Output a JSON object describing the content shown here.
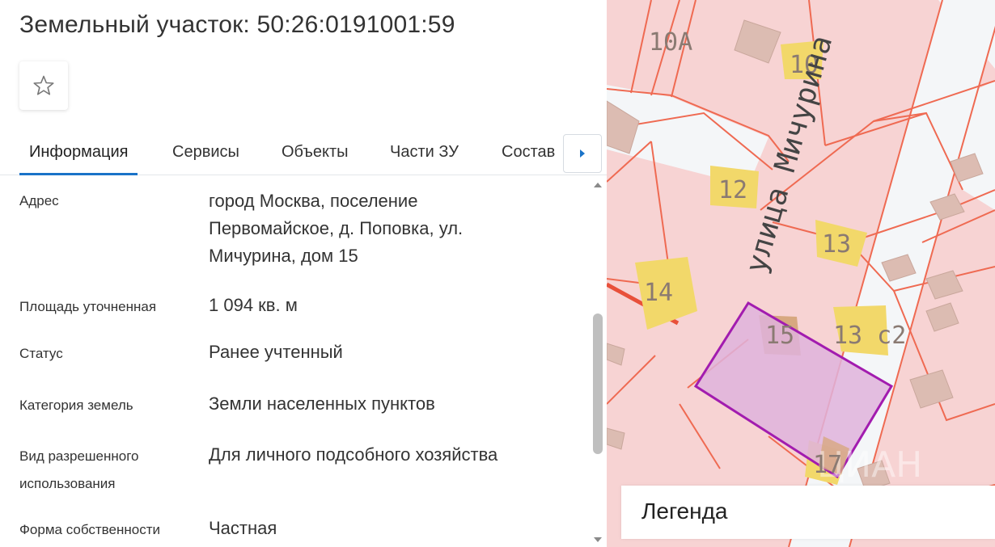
{
  "header": {
    "title": "Земельный участок: 50:26:0191001:59",
    "favorite_icon": "star-icon"
  },
  "tabs": [
    {
      "label": "Информация",
      "active": true
    },
    {
      "label": "Сервисы",
      "active": false
    },
    {
      "label": "Объекты",
      "active": false
    },
    {
      "label": "Части ЗУ",
      "active": false
    },
    {
      "label": "Состав",
      "active": false
    }
  ],
  "tabs_next_icon": "caret-right-icon",
  "info": {
    "address": {
      "label": "Адрес",
      "lines": [
        "город Москва, поселение",
        "Первомайское, д. Поповка, ул.",
        "Мичурина, дом 15"
      ]
    },
    "area": {
      "label": "Площадь уточненная",
      "value": "1 094 кв. м"
    },
    "status": {
      "label": "Статус",
      "value": "Ранее учтенный"
    },
    "category": {
      "label": "Категория земель",
      "value": "Земли населенных пунктов"
    },
    "permitted_use": {
      "label_lines": [
        "Вид разрешенного",
        "использования"
      ],
      "value": "Для личного подсобного хозяйства"
    },
    "ownership": {
      "label": "Форма собственности",
      "value": "Частная"
    }
  },
  "map": {
    "street_name": "улица Мичурина",
    "house_numbers": [
      "10А",
      "10",
      "12",
      "13",
      "14",
      "15",
      "13 с2",
      "17"
    ],
    "highlighted_house": "15",
    "watermark": "ЦИАН",
    "colors": {
      "parcel_fill": "#f7d3d3",
      "parcel_border": "#ef6a52",
      "street": "#f4f6f8",
      "building": "#dcbcb2",
      "label_bg": "#f2d86a",
      "highlight": "#a21caf"
    }
  },
  "legend": {
    "label": "Легенда"
  },
  "colors": {
    "accent": "#1a73c8",
    "text": "#333333"
  }
}
